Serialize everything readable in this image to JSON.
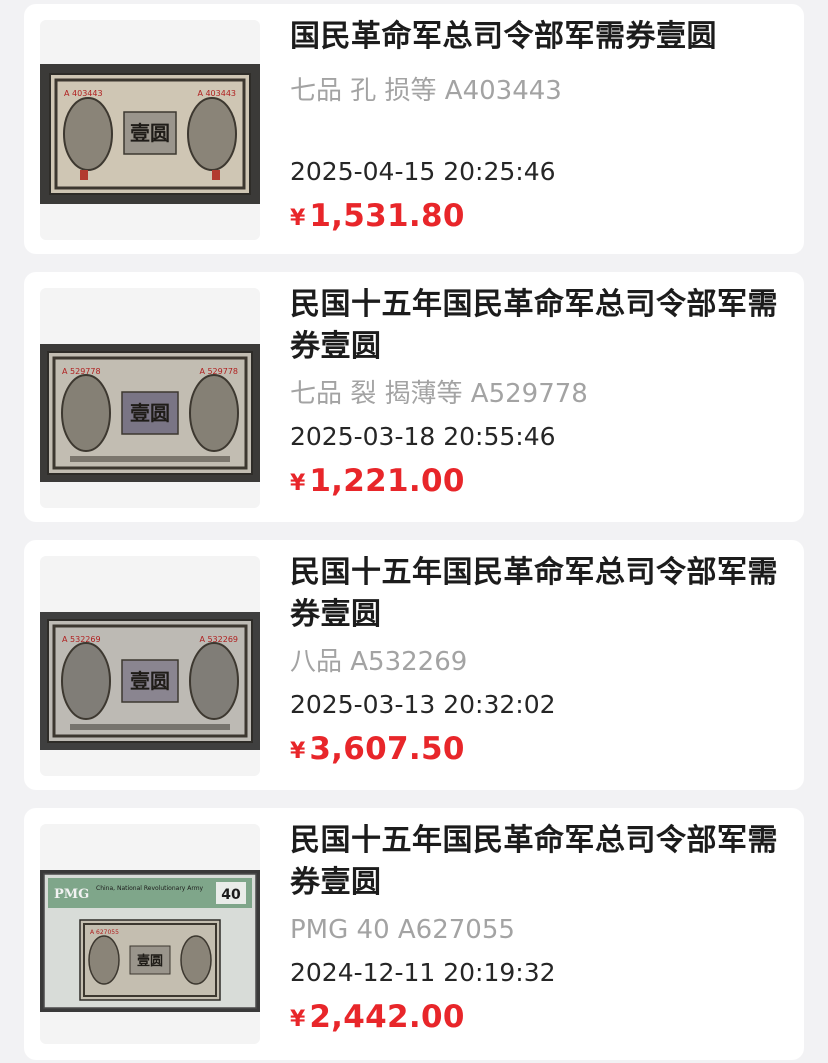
{
  "currency_symbol": "¥",
  "listings": [
    {
      "title": "国民革命军总司令部军需券壹圆",
      "grade": "七品 孔 损等 A403443",
      "date": "2025-04-15 20:25:46",
      "price": "1,531.80",
      "image": {
        "serial": "A 403443",
        "denomination": "壹圆",
        "pmg": false
      }
    },
    {
      "title": "民国十五年国民革命军总司令部军需券壹圆",
      "grade": "七品 裂 揭薄等 A529778",
      "date": "2025-03-18 20:55:46",
      "price": "1,221.00",
      "image": {
        "serial": "A 529778",
        "denomination": "壹圆",
        "pmg": false
      }
    },
    {
      "title": "民国十五年国民革命军总司令部军需券壹圆",
      "grade": "八品 A532269",
      "date": "2025-03-13 20:32:02",
      "price": "3,607.50",
      "image": {
        "serial": "A 532269",
        "denomination": "壹圆",
        "pmg": false
      }
    },
    {
      "title": "民国十五年国民革命军总司令部军需券壹圆",
      "grade": "PMG 40 A627055",
      "date": "2024-12-11 20:19:32",
      "price": "2,442.00",
      "image": {
        "serial": "A 627055",
        "denomination": "壹圆",
        "pmg": true,
        "pmg_label": "PMG",
        "pmg_text": "China, National Revolutionary Army",
        "pmg_score": "40"
      }
    }
  ]
}
